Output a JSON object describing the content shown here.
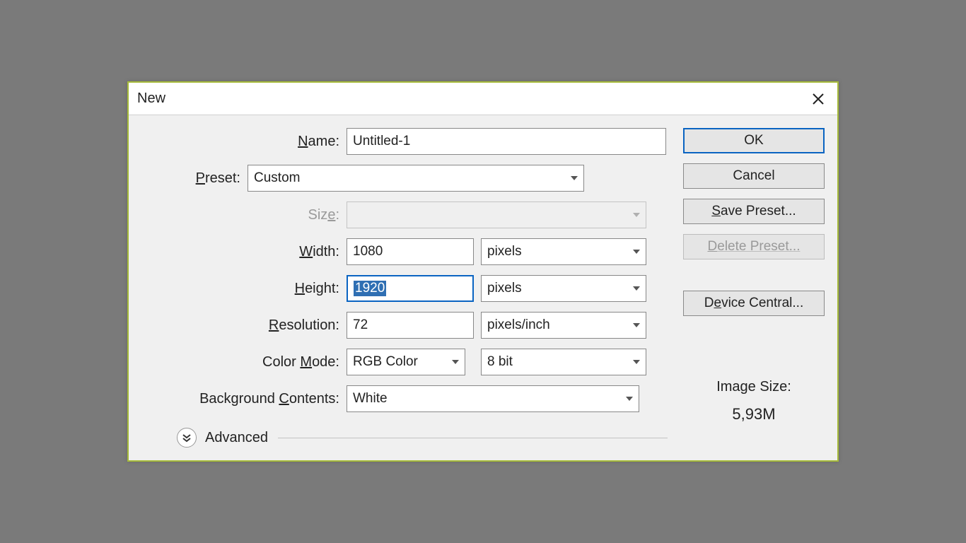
{
  "dialog": {
    "title": "New",
    "labels": {
      "name": "Name:",
      "preset": "Preset:",
      "size": "Size:",
      "width": "Width:",
      "height": "Height:",
      "resolution": "Resolution:",
      "color_mode": "Color Mode:",
      "background_contents": "Background Contents:",
      "advanced": "Advanced"
    },
    "fields": {
      "name": "Untitled-1",
      "preset": "Custom",
      "size": "",
      "width": "1080",
      "width_unit": "pixels",
      "height": "1920",
      "height_unit": "pixels",
      "resolution": "72",
      "resolution_unit": "pixels/inch",
      "color_mode": "RGB Color",
      "bit_depth": "8 bit",
      "background_contents": "White"
    },
    "buttons": {
      "ok": "OK",
      "cancel": "Cancel",
      "save_preset": "Save Preset...",
      "delete_preset": "Delete Preset...",
      "device_central": "Device Central..."
    },
    "image_size": {
      "label": "Image Size:",
      "value": "5,93M"
    }
  }
}
